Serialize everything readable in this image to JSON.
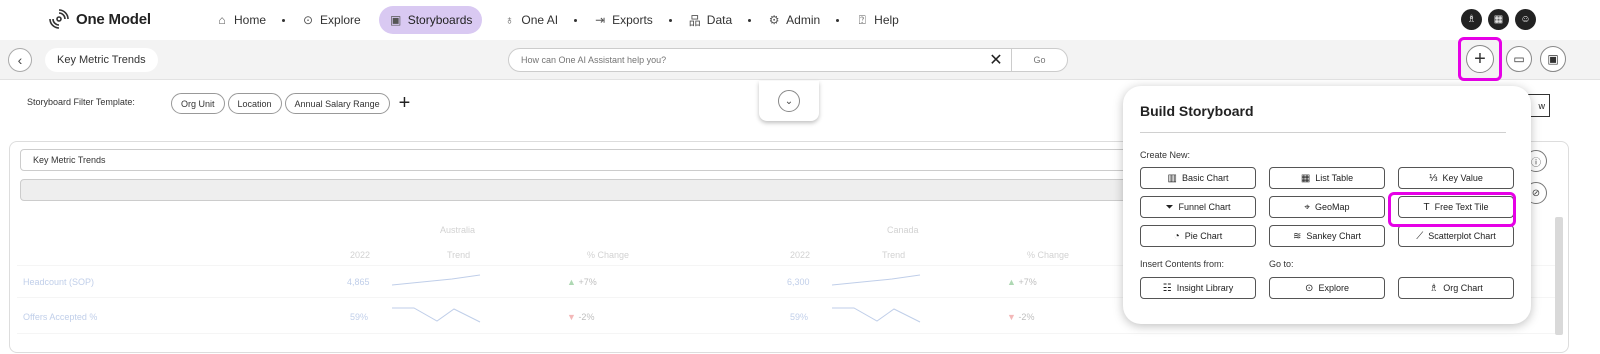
{
  "app": {
    "name": "One Model"
  },
  "nav": {
    "items": [
      {
        "label": "Home",
        "icon": "home-icon",
        "glyph": "⌂"
      },
      {
        "label": "Explore",
        "icon": "compass-icon",
        "glyph": "⊙"
      },
      {
        "label": "Storyboards",
        "icon": "storyboard-icon",
        "glyph": "▣"
      },
      {
        "label": "One AI",
        "icon": "lightbulb-icon",
        "glyph": "♁"
      },
      {
        "label": "Exports",
        "icon": "export-icon",
        "glyph": "⇥"
      },
      {
        "label": "Data",
        "icon": "data-icon",
        "glyph": "品"
      },
      {
        "label": "Admin",
        "icon": "gear-icon",
        "glyph": "⚙"
      },
      {
        "label": "Help",
        "icon": "help-icon",
        "glyph": "⍰"
      }
    ],
    "active": "Storyboards"
  },
  "subbar": {
    "breadcrumb": "Key Metric Trends",
    "assistant_placeholder": "How can One AI Assistant help you?",
    "go_label": "Go"
  },
  "filters": {
    "label": "Storyboard Filter Template:",
    "chips": [
      "Org Unit",
      "Location",
      "Annual Salary Range"
    ]
  },
  "partial_button_label": "w",
  "tile": {
    "title": "Key Metric Trends",
    "groups": [
      "Australia",
      "Canada"
    ],
    "columns": [
      "2022",
      "Trend",
      "% Change"
    ],
    "rows": [
      {
        "label": "Headcount (SOP)",
        "australia": {
          "value": "4,865",
          "change": "+7%",
          "dir": "up"
        },
        "canada": {
          "value": "6,300",
          "change": "+7%",
          "dir": "up"
        }
      },
      {
        "label": "Offers Accepted %",
        "australia": {
          "value": "59%",
          "change": "-2%",
          "dir": "down"
        },
        "canada": {
          "value": "59%",
          "change": "-2%",
          "dir": "down"
        }
      }
    ]
  },
  "panel": {
    "title": "Build Storyboard",
    "create_new_label": "Create New:",
    "create_buttons": [
      {
        "label": "Basic Chart",
        "icon": "bar-chart-icon",
        "glyph": "▥"
      },
      {
        "label": "List Table",
        "icon": "table-icon",
        "glyph": "▦"
      },
      {
        "label": "Key Value",
        "icon": "key-value-icon",
        "glyph": "⅓"
      },
      {
        "label": "Funnel Chart",
        "icon": "funnel-icon",
        "glyph": "⏷"
      },
      {
        "label": "GeoMap",
        "icon": "map-pin-icon",
        "glyph": "⌖"
      },
      {
        "label": "Free Text Tile",
        "icon": "text-icon",
        "glyph": "T"
      },
      {
        "label": "Pie Chart",
        "icon": "pie-chart-icon",
        "glyph": "◔"
      },
      {
        "label": "Sankey Chart",
        "icon": "sankey-icon",
        "glyph": "≋"
      },
      {
        "label": "Scatterplot Chart",
        "icon": "scatterplot-icon",
        "glyph": "⟋"
      }
    ],
    "insert_label": "Insert Contents from:",
    "goto_label": "Go to:",
    "bottom_buttons": [
      {
        "label": "Insight Library",
        "icon": "library-icon",
        "glyph": "☷"
      },
      {
        "label": "Explore",
        "icon": "compass-icon",
        "glyph": "⊙"
      },
      {
        "label": "Org Chart",
        "icon": "org-chart-icon",
        "glyph": "♗"
      }
    ]
  },
  "colors": {
    "active_nav": "#d9c9f2",
    "highlight": "#e600e6",
    "up": "#2e9b3a",
    "down": "#e04848"
  }
}
